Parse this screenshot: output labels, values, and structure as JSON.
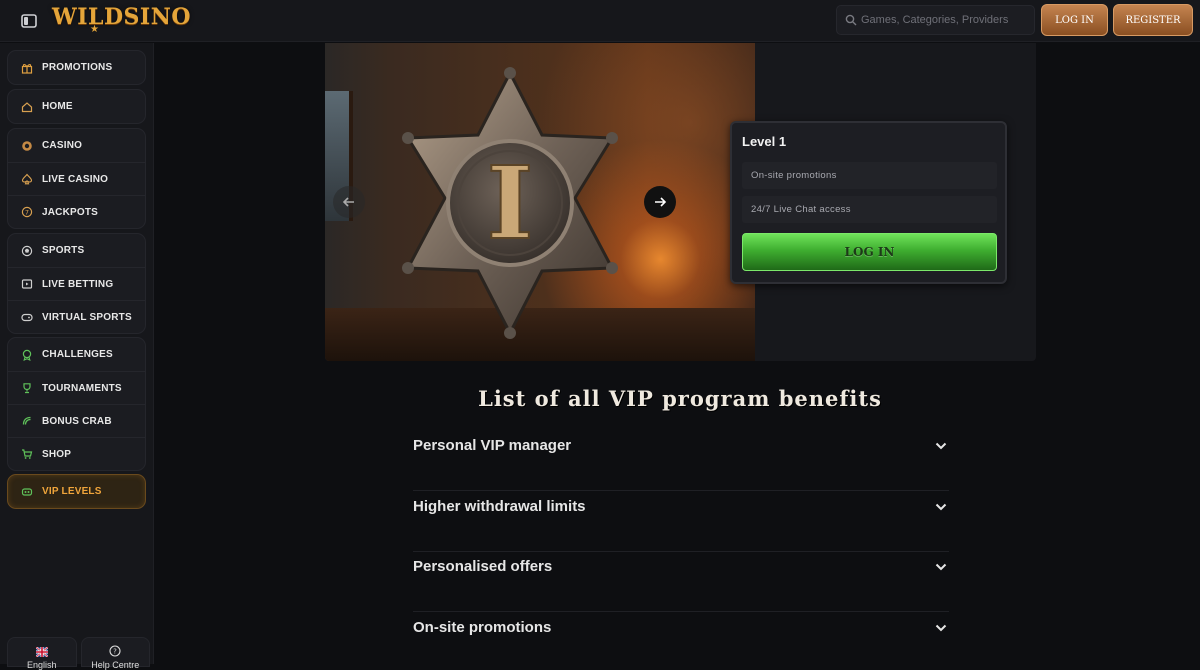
{
  "header": {
    "logo": "WILDSINO",
    "search_placeholder": "Games, Categories, Providers",
    "login_label": "LOG IN",
    "register_label": "REGISTER"
  },
  "sidebar": {
    "groups": [
      {
        "items": [
          {
            "label": "PROMOTIONS",
            "icon": "gift-icon"
          }
        ]
      },
      {
        "items": [
          {
            "label": "HOME",
            "icon": "home-icon"
          }
        ]
      },
      {
        "items": [
          {
            "label": "CASINO",
            "icon": "casino-chip-icon"
          },
          {
            "label": "LIVE CASINO",
            "icon": "spade-icon"
          },
          {
            "label": "JACKPOTS",
            "icon": "coin-icon"
          }
        ]
      },
      {
        "items": [
          {
            "label": "SPORTS",
            "icon": "ball-icon"
          },
          {
            "label": "LIVE BETTING",
            "icon": "live-icon"
          },
          {
            "label": "VIRTUAL SPORTS",
            "icon": "gamepad-icon"
          }
        ]
      },
      {
        "items": [
          {
            "label": "CHALLENGES",
            "icon": "challenge-icon"
          },
          {
            "label": "TOURNAMENTS",
            "icon": "trophy-icon"
          },
          {
            "label": "BONUS CRAB",
            "icon": "crab-icon"
          },
          {
            "label": "SHOP",
            "icon": "cart-icon"
          }
        ]
      },
      {
        "items": [
          {
            "label": "VIP LEVELS",
            "icon": "vip-icon"
          }
        ]
      }
    ],
    "language": "English",
    "help": "Help Centre"
  },
  "hero": {
    "badge_numeral": "I",
    "level_title": "Level 1",
    "perks": [
      "On-site promotions",
      "24/7 Live Chat access"
    ],
    "login_label": "LOG IN"
  },
  "benefits": {
    "title": "List of all VIP program benefits",
    "items": [
      "Personal VIP manager",
      "Higher withdrawal limits",
      "Personalised offers",
      "On-site promotions"
    ]
  },
  "colors": {
    "accent_gold": "#e4a53a",
    "button_bronze": "#a8693a",
    "button_green": "#3fae30",
    "background": "#0d0e11"
  }
}
